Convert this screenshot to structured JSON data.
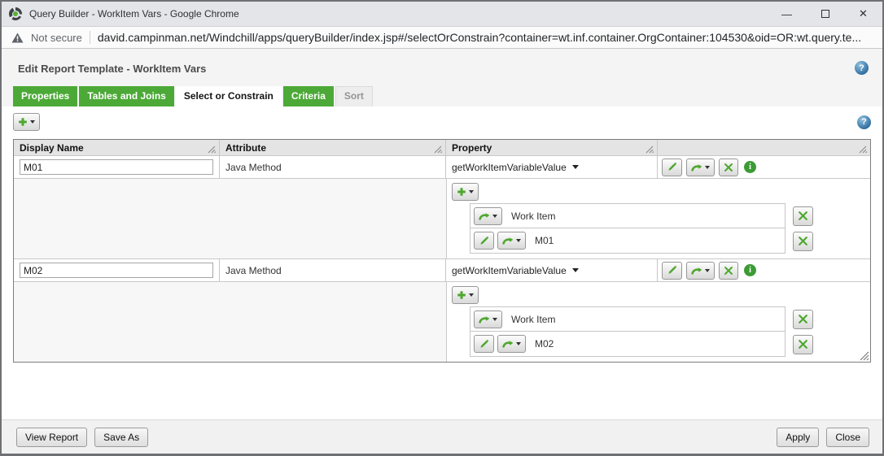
{
  "window": {
    "title": "Query Builder - WorkItem Vars - Google Chrome",
    "controls": {
      "minimize": "—",
      "close": "✕"
    }
  },
  "address_bar": {
    "security_label": "Not secure",
    "url": "david.campinman.net/Windchill/apps/queryBuilder/index.jsp#/selectOrConstrain?container=wt.inf.container.OrgContainer:104530&oid=OR:wt.query.te..."
  },
  "page": {
    "title": "Edit Report Template - WorkItem Vars",
    "tabs": [
      {
        "label": "Properties"
      },
      {
        "label": "Tables and Joins"
      },
      {
        "label": "Select or Constrain"
      },
      {
        "label": "Criteria"
      },
      {
        "label": "Sort"
      }
    ]
  },
  "icons": {
    "help": "?",
    "info": "i"
  },
  "table": {
    "columns": {
      "display_name": "Display Name",
      "attribute": "Attribute",
      "property": "Property"
    },
    "rows": [
      {
        "display_name": "M01",
        "attribute": "Java Method",
        "property": "getWorkItemVariableValue",
        "parameters": [
          {
            "label": "Work Item"
          },
          {
            "label": "M01"
          }
        ]
      },
      {
        "display_name": "M02",
        "attribute": "Java Method",
        "property": "getWorkItemVariableValue",
        "parameters": [
          {
            "label": "Work Item"
          },
          {
            "label": "M02"
          }
        ]
      }
    ]
  },
  "footer": {
    "view_report": "View Report",
    "save_as": "Save As",
    "apply": "Apply",
    "close": "Close"
  },
  "colors": {
    "accent_green": "#4EA72E",
    "tab_green": "#4CA937",
    "help_blue": "#336F9E",
    "info_green": "#3C9B35"
  }
}
